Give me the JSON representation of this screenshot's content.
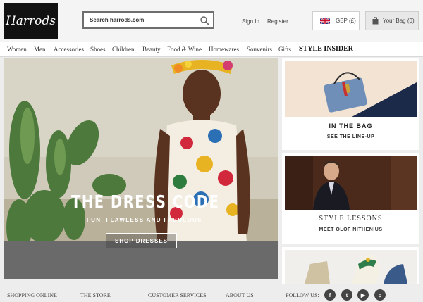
{
  "header": {
    "logo_text": "Harrods",
    "search_placeholder": "Search harrods.com",
    "signin_label": "Sign In",
    "register_label": "Register",
    "currency_label": "GBP (£)",
    "bag_label": "Your Bag (0)"
  },
  "nav": {
    "items": [
      "Women",
      "Men",
      "Accessories",
      "Shoes",
      "Children",
      "Beauty",
      "Food & Wine",
      "Homewares",
      "Souvenirs",
      "Gifts",
      "STYLE INSIDER"
    ]
  },
  "hero": {
    "title": "THE DRESS CODE",
    "subtitle": "FUN, FLAWLESS AND FABULOUS",
    "button_label": "SHOP DRESSES"
  },
  "cards": [
    {
      "title": "IN THE BAG",
      "subtitle": "SEE THE LINE-UP"
    },
    {
      "title": "STYLE LESSONS",
      "subtitle": "MEET OLOF NITHENIUS"
    }
  ],
  "footer": {
    "links": [
      "SHOPPING ONLINE",
      "THE STORE",
      "CUSTOMER SERVICES",
      "ABOUT US"
    ],
    "follow_label": "FOLLOW US:",
    "social_icons": [
      "facebook-icon",
      "twitter-icon",
      "youtube-icon",
      "pinterest-icon"
    ]
  },
  "colors": {
    "accent": "#111111",
    "hero_bar": "#6a6a6a"
  }
}
